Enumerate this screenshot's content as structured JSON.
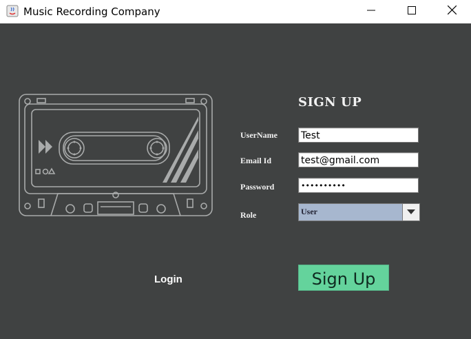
{
  "window": {
    "title": "Music Recording Company"
  },
  "form": {
    "heading": "SIGN UP",
    "username_label": "UserName",
    "username_value": "Test",
    "email_label": "Email Id",
    "email_value": "test@gmail.com",
    "password_label": "Password",
    "password_value": "••••••••••",
    "role_label": "Role",
    "role_value": "User",
    "signup_label": "Sign Up",
    "login_label": "Login"
  },
  "colors": {
    "background": "#404242",
    "signup_button": "#64d39c",
    "role_select": "#a7b7cf"
  }
}
